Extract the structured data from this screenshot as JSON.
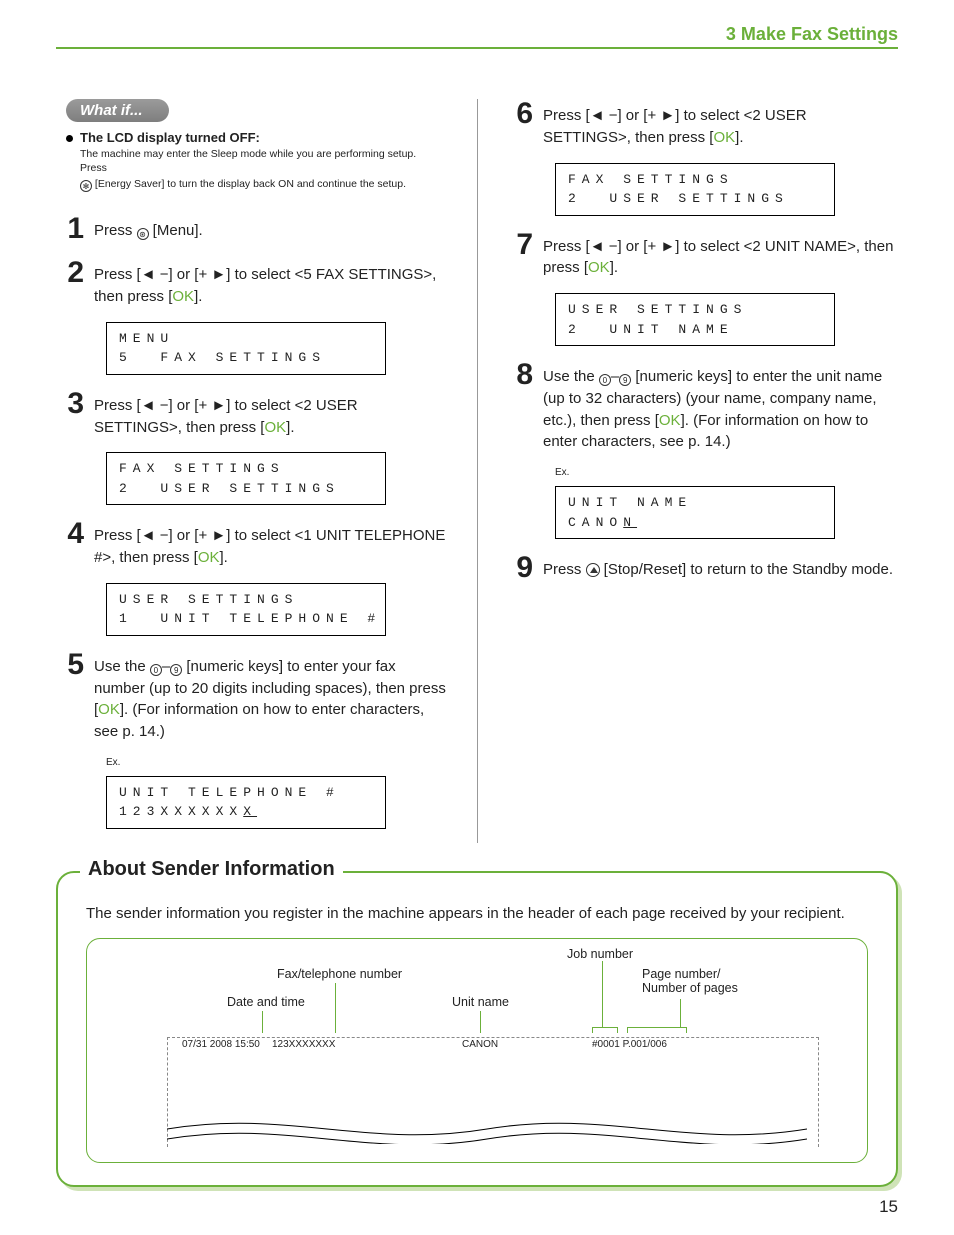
{
  "header": {
    "title": "3 Make Fax Settings"
  },
  "whatif": {
    "pill": "What if...",
    "heading": "The LCD display turned OFF:",
    "line1": "The machine may enter the Sleep mode while you are performing setup. Press",
    "line2": " [Energy Saver] to turn the display back ON and continue the setup."
  },
  "left_steps": {
    "s1": {
      "num": "1",
      "body": "Press  [Menu].",
      "icon_at": 6
    },
    "s2": {
      "num": "2",
      "pre": "Press [",
      "arrL": "◄ −",
      "mid": "] or [",
      "arrR": "+ ►",
      "post1": "] to select <5 FAX SETTINGS>, then press [",
      "ok": "OK",
      "post2": "].",
      "lcd": "MENU\n5  FAX SETTINGS"
    },
    "s3": {
      "num": "3",
      "pre": "Press [",
      "arrL": "◄ −",
      "mid": "] or [",
      "arrR": "+ ►",
      "post1": "] to select <2 USER SETTINGS>, then press [",
      "ok": "OK",
      "post2": "].",
      "lcd": "FAX SETTINGS\n2  USER SETTINGS"
    },
    "s4": {
      "num": "4",
      "pre": "Press [",
      "arrL": "◄ −",
      "mid": "] or [",
      "arrR": "+ ►",
      "post1": "] to select <1 UNIT TELEPHONE #>, then press [",
      "ok": "OK",
      "post2": "].",
      "lcd": "USER SETTINGS\n1  UNIT TELEPHONE #"
    },
    "s5": {
      "num": "5",
      "t1": "Use the ",
      "t2": "–",
      "t3": " [numeric keys] to enter your fax number (up to 20 digits including spaces), then press [",
      "ok": "OK",
      "t4": "]. (For information on how to enter characters, see p. 14.)",
      "ex": "Ex.",
      "lcd_line1": "UNIT TELEPHONE #",
      "lcd_line2_a": "123XXXXXX",
      "lcd_line2_b": "X"
    }
  },
  "right_steps": {
    "s6": {
      "num": "6",
      "pre": "Press [",
      "arrL": "◄ −",
      "mid": "] or [",
      "arrR": "+ ►",
      "post1": "] to select <2 USER SETTINGS>, then press [",
      "ok": "OK",
      "post2": "].",
      "lcd": "FAX SETTINGS\n2  USER SETTINGS"
    },
    "s7": {
      "num": "7",
      "pre": "Press [",
      "arrL": "◄ −",
      "mid": "] or [",
      "arrR": "+ ►",
      "post1": "] to select <2 UNIT NAME>, then press [",
      "ok": "OK",
      "post2": "].",
      "lcd": "USER SETTINGS\n2  UNIT NAME"
    },
    "s8": {
      "num": "8",
      "t1": "Use the ",
      "t2": "–",
      "t3": " [numeric keys] to enter the unit name (up to 32 characters) (your name, company name, etc.), then press [",
      "ok": "OK",
      "t4": "]. (For information on how to enter characters, see p. 14.)",
      "ex": "Ex.",
      "lcd_line1": "UNIT NAME",
      "lcd_line2_a": "CANO",
      "lcd_line2_b": "N"
    },
    "s9": {
      "num": "9",
      "body": "Press  [Stop/Reset] to return to the Standby mode."
    }
  },
  "about": {
    "title": "About Sender Information",
    "intro": "The sender information you register in the machine appears in the header of each page received by your recipient.",
    "labels": {
      "jobnum": "Job number",
      "faxtel": "Fax/telephone number",
      "pagenum": "Page number/\nNumber of pages",
      "datetime": "Date and time",
      "unitname": "Unit name"
    },
    "strip": {
      "datetime": "07/31 2008 15:50",
      "fax": "123XXXXXXX",
      "unit": "CANON",
      "job_page": "#0001 P.001/006"
    }
  },
  "page_number": "15"
}
